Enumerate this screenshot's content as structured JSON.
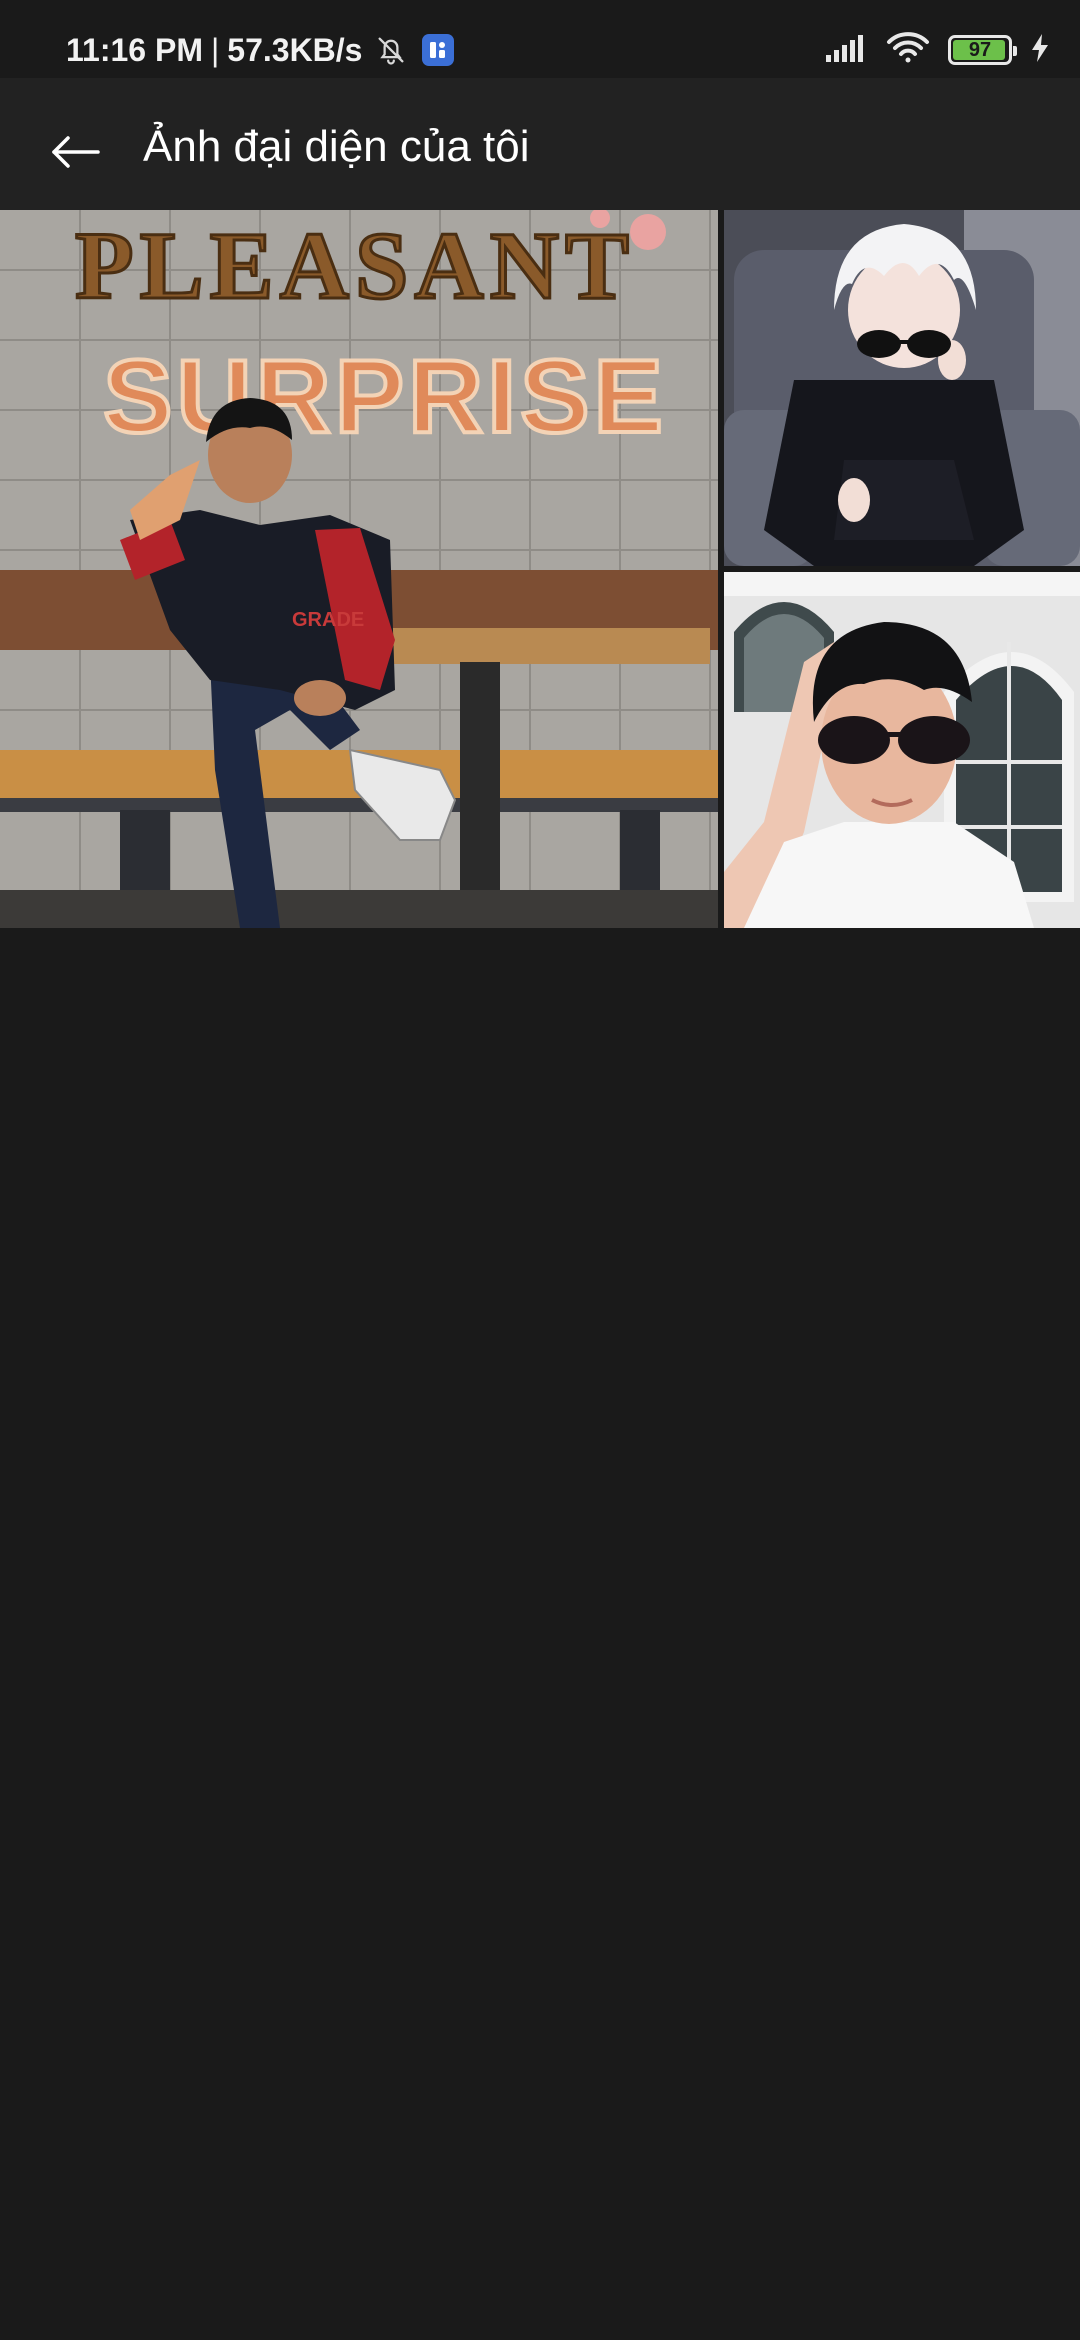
{
  "status_bar": {
    "time": "11:16 PM",
    "separator": "|",
    "network_speed": "57.3KB/s",
    "battery_level": "97",
    "icons": [
      "bell-off-icon",
      "app-badge-icon",
      "signal-icon",
      "wifi-icon",
      "battery-icon",
      "charging-icon"
    ]
  },
  "header": {
    "title": "Ảnh đại diện của tôi",
    "back_icon": "arrow-left-icon"
  },
  "photos": {
    "main": {
      "sign_top": "PLEASANT",
      "sign_bottom": "SURPRISE",
      "shirt_text": "GRADE"
    },
    "anime": {},
    "selfie": {}
  },
  "colors": {
    "background": "#1a1a1a",
    "header": "#222222",
    "battery": "#6cc04a",
    "badge": "#3b6fd6"
  }
}
